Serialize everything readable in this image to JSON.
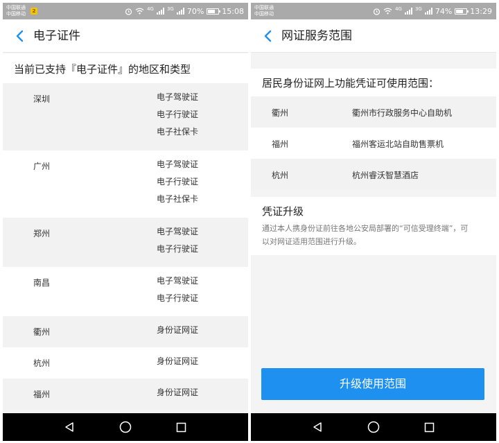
{
  "left": {
    "status": {
      "carrier1": "中国联通",
      "carrier2": "中国移动",
      "sim_badge": "2",
      "net1": "4G",
      "net2": "3G",
      "battery_text": "70%",
      "battery_level": 70,
      "time": "15:08"
    },
    "title": "电子证件",
    "section_title": "当前已支持『电子证件』的地区和类型",
    "regions": [
      {
        "city": "深圳",
        "types": [
          "电子驾驶证",
          "电子行驶证",
          "电子社保卡"
        ]
      },
      {
        "city": "广州",
        "types": [
          "电子驾驶证",
          "电子行驶证",
          "电子社保卡"
        ]
      },
      {
        "city": "郑州",
        "types": [
          "电子驾驶证",
          "电子行驶证"
        ]
      },
      {
        "city": "南昌",
        "types": [
          "电子驾驶证",
          "电子行驶证"
        ]
      },
      {
        "city": "衢州",
        "types": [
          "身份证网证"
        ]
      },
      {
        "city": "杭州",
        "types": [
          "身份证网证"
        ]
      },
      {
        "city": "福州",
        "types": [
          "身份证网证"
        ]
      }
    ]
  },
  "right": {
    "status": {
      "carrier1": "中国联通",
      "carrier2": "中国移动",
      "net1": "4G",
      "net2": "3G",
      "battery_text": "74%",
      "battery_level": 74,
      "time": "13:29"
    },
    "title": "网证服务范围",
    "scope_title": "居民身份证网上功能凭证可使用范围：",
    "scopes": [
      {
        "city": "衢州",
        "place": "衢州市行政服务中心自助机"
      },
      {
        "city": "福州",
        "place": "福州客运北站自助售票机"
      },
      {
        "city": "杭州",
        "place": "杭州睿沃智慧酒店"
      }
    ],
    "upgrade_title": "凭证升级",
    "upgrade_desc": "通过本人携身份证前往各地公安局部署的“可信受理终端”，可以对网证适用范围进行升级。",
    "upgrade_button": "升级使用范围"
  },
  "icons": {
    "back": "chevron-left-icon",
    "nav_back": "triangle-back-icon",
    "nav_home": "circle-home-icon",
    "nav_recent": "square-recent-icon"
  },
  "colors": {
    "accent": "#1e90f0",
    "statusbar": "#aaaaaa",
    "navbar": "#000000"
  }
}
